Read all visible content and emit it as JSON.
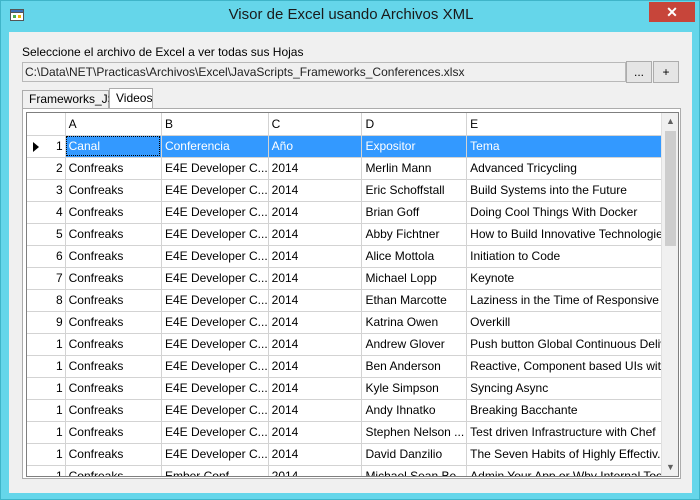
{
  "window": {
    "title": "Visor de Excel usando Archivos XML",
    "close_label": "✕"
  },
  "form": {
    "prompt": "Seleccione el archivo de Excel a ver todas sus Hojas",
    "path_value": "C:\\Data\\NET\\Practicas\\Archivos\\Excel\\JavaScripts_Frameworks_Conferences.xlsx",
    "browse_label": "...",
    "add_label": "+"
  },
  "tabs": [
    {
      "label": "Frameworks_JS",
      "active": false
    },
    {
      "label": "Videos",
      "active": true
    }
  ],
  "grid": {
    "columns": [
      "A",
      "B",
      "C",
      "D",
      "E"
    ],
    "rows": [
      {
        "num": "1",
        "cells": [
          "Canal",
          "Conferencia",
          "Año",
          "Expositor",
          "Tema"
        ]
      },
      {
        "num": "2",
        "cells": [
          "Confreaks",
          "E4E Developer C...",
          "2014",
          "Merlin Mann",
          "Advanced Tricycling"
        ]
      },
      {
        "num": "3",
        "cells": [
          "Confreaks",
          "E4E Developer C...",
          "2014",
          "Eric Schoffstall",
          "Build Systems into the Future"
        ]
      },
      {
        "num": "4",
        "cells": [
          "Confreaks",
          "E4E Developer C...",
          "2014",
          "Brian Goff",
          "Doing Cool Things With Docker"
        ]
      },
      {
        "num": "5",
        "cells": [
          "Confreaks",
          "E4E Developer C...",
          "2014",
          "Abby Fichtner",
          "How to Build Innovative Technologies"
        ]
      },
      {
        "num": "6",
        "cells": [
          "Confreaks",
          "E4E Developer C...",
          "2014",
          "Alice Mottola",
          "Initiation to Code"
        ]
      },
      {
        "num": "7",
        "cells": [
          "Confreaks",
          "E4E Developer C...",
          "2014",
          "Michael Lopp",
          "Keynote"
        ]
      },
      {
        "num": "8",
        "cells": [
          "Confreaks",
          "E4E Developer C...",
          "2014",
          "Ethan Marcotte",
          "Laziness in the Time of Responsive ..."
        ]
      },
      {
        "num": "9",
        "cells": [
          "Confreaks",
          "E4E Developer C...",
          "2014",
          "Katrina Owen",
          "Overkill"
        ]
      },
      {
        "num": "1",
        "cells": [
          "Confreaks",
          "E4E Developer C...",
          "2014",
          "Andrew Glover",
          "Push button Global Continuous Deliver"
        ]
      },
      {
        "num": "1",
        "cells": [
          "Confreaks",
          "E4E Developer C...",
          "2014",
          "Ben Anderson",
          "Reactive, Component based UIs wit..."
        ]
      },
      {
        "num": "1",
        "cells": [
          "Confreaks",
          "E4E Developer C...",
          "2014",
          "Kyle Simpson",
          "Syncing Async"
        ]
      },
      {
        "num": "1",
        "cells": [
          "Confreaks",
          "E4E Developer C...",
          "2014",
          "Andy Ihnatko",
          "Breaking Bacchante"
        ]
      },
      {
        "num": "1",
        "cells": [
          "Confreaks",
          "E4E Developer C...",
          "2014",
          "Stephen Nelson ...",
          "Test driven Infrastructure with Chef"
        ]
      },
      {
        "num": "1",
        "cells": [
          "Confreaks",
          "E4E Developer C...",
          "2014",
          "David Danzilio",
          "The Seven Habits of Highly Effectiv..."
        ]
      },
      {
        "num": "1",
        "cells": [
          "Confreaks",
          "Ember Conf",
          "2014",
          "Michael Sean Be...",
          "Admin Your App or Why Internal Too..."
        ]
      }
    ]
  },
  "colors": {
    "window_frame": "#65d6ea",
    "selection": "#3399ff",
    "close_button": "#c7453a"
  }
}
